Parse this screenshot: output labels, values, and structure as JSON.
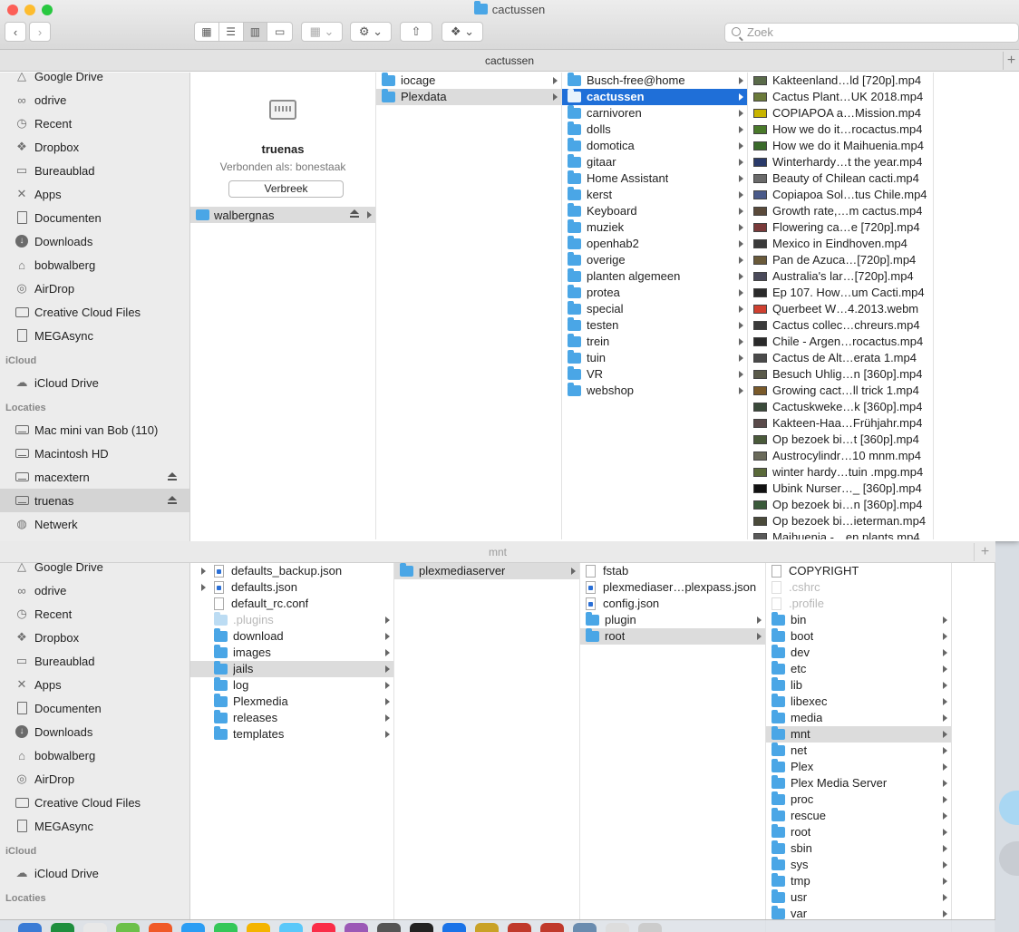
{
  "top": {
    "title": "cactussen",
    "path_title": "cactussen",
    "search_placeholder": "Zoek",
    "sidebar": {
      "items_a": [
        {
          "label": "Google Drive",
          "icon": "google-drive-icon",
          "glyph": "△"
        },
        {
          "label": "odrive",
          "icon": "odrive-icon",
          "glyph": "∞"
        },
        {
          "label": "Recent",
          "icon": "clock-icon",
          "glyph": "◷"
        },
        {
          "label": "Dropbox",
          "icon": "dropbox-icon",
          "glyph": "❖"
        },
        {
          "label": "Bureaublad",
          "icon": "desktop-icon",
          "glyph": "▭"
        },
        {
          "label": "Apps",
          "icon": "apps-icon",
          "glyph": "✕"
        },
        {
          "label": "Documenten",
          "icon": "document-icon",
          "glyph": "▯"
        },
        {
          "label": "Downloads",
          "icon": "downloads-icon",
          "glyph": "↓"
        },
        {
          "label": "bobwalberg",
          "icon": "home-icon",
          "glyph": "⌂"
        },
        {
          "label": "AirDrop",
          "icon": "airdrop-icon",
          "glyph": "◎"
        },
        {
          "label": "Creative Cloud Files",
          "icon": "folder-icon",
          "glyph": "▭"
        },
        {
          "label": "MEGAsync",
          "icon": "document-icon",
          "glyph": "▯"
        }
      ],
      "section_icloud": "iCloud",
      "icloud_drive": "iCloud Drive",
      "section_locaties": "Locaties",
      "items_b": [
        {
          "label": "Mac mini van Bob (110)",
          "icon": "computer-icon",
          "eject": false
        },
        {
          "label": "Macintosh HD",
          "icon": "disk-icon",
          "eject": false
        },
        {
          "label": "macextern",
          "icon": "external-disk-icon",
          "eject": true
        },
        {
          "label": "truenas",
          "icon": "server-icon",
          "eject": true,
          "selected": true
        },
        {
          "label": "Netwerk",
          "icon": "network-icon",
          "eject": false
        }
      ]
    },
    "server": {
      "name": "truenas",
      "connected_as": "Verbonden als: bonestaak",
      "disconnect_label": "Verbreek",
      "share": "walbergnas"
    },
    "col2": [
      {
        "label": "iocage",
        "sel": ""
      },
      {
        "label": "Plexdata",
        "sel": "grey"
      }
    ],
    "col3": [
      {
        "label": "Busch-free@home",
        "sel": ""
      },
      {
        "label": "cactussen",
        "sel": "blue"
      },
      {
        "label": "carnivoren",
        "sel": ""
      },
      {
        "label": "dolls",
        "sel": ""
      },
      {
        "label": "domotica",
        "sel": ""
      },
      {
        "label": "gitaar",
        "sel": ""
      },
      {
        "label": "Home Assistant",
        "sel": ""
      },
      {
        "label": "kerst",
        "sel": ""
      },
      {
        "label": "Keyboard",
        "sel": ""
      },
      {
        "label": "muziek",
        "sel": ""
      },
      {
        "label": "openhab2",
        "sel": ""
      },
      {
        "label": "overige",
        "sel": ""
      },
      {
        "label": "planten algemeen",
        "sel": ""
      },
      {
        "label": "protea",
        "sel": ""
      },
      {
        "label": "special",
        "sel": ""
      },
      {
        "label": "testen",
        "sel": ""
      },
      {
        "label": "trein",
        "sel": ""
      },
      {
        "label": "tuin",
        "sel": ""
      },
      {
        "label": "VR",
        "sel": ""
      },
      {
        "label": "webshop",
        "sel": ""
      }
    ],
    "col4": [
      {
        "label": "Kakteenland…ld [720p].mp4",
        "color": "#5a6b4a"
      },
      {
        "label": "Cactus Plant…UK 2018.mp4",
        "color": "#6b7a3a"
      },
      {
        "label": "COPIAPOA a…Mission.mp4",
        "color": "#c8b400"
      },
      {
        "label": "How we do it…rocactus.mp4",
        "color": "#4a7a2a"
      },
      {
        "label": "How we do it Maihuenia.mp4",
        "color": "#3a6a2a"
      },
      {
        "label": "Winterhardy…t the year.mp4",
        "color": "#2a3a6a"
      },
      {
        "label": "Beauty of Chilean cacti.mp4",
        "color": "#6a6a6a"
      },
      {
        "label": "Copiapoa Sol…tus Chile.mp4",
        "color": "#4a5a8a"
      },
      {
        "label": "Growth rate,…m cactus.mp4",
        "color": "#5a4a3a"
      },
      {
        "label": "Flowering ca…e [720p].mp4",
        "color": "#7a3a3a"
      },
      {
        "label": "Mexico in Eindhoven.mp4",
        "color": "#3a3a3a"
      },
      {
        "label": "Pan de Azuca…[720p].mp4",
        "color": "#6a5a3a"
      },
      {
        "label": "Australia's lar…[720p].mp4",
        "color": "#4a4a5a"
      },
      {
        "label": "Ep 107. How…um Cacti.mp4",
        "color": "#2a2a2a"
      },
      {
        "label": "Querbeet   W…4.2013.webm",
        "color": "#d04030"
      },
      {
        "label": "Cactus collec…chreurs.mp4",
        "color": "#3a3a3a"
      },
      {
        "label": "Chile - Argen…rocactus.mp4",
        "color": "#2a2a2a"
      },
      {
        "label": "Cactus de Alt…erata 1.mp4",
        "color": "#4a4a4a"
      },
      {
        "label": "Besuch Uhlig…n [360p].mp4",
        "color": "#5a5a4a"
      },
      {
        "label": "Growing cact…ll trick 1.mp4",
        "color": "#7a5a2a"
      },
      {
        "label": "Cactuskweke…k [360p].mp4",
        "color": "#3a4a3a"
      },
      {
        "label": "Kakteen-Haa…Frühjahr.mp4",
        "color": "#5a4a4a"
      },
      {
        "label": "Op bezoek bi…t [360p].mp4",
        "color": "#4a5a3a"
      },
      {
        "label": "Austrocylindr…10 mnm.mp4",
        "color": "#6a6a5a"
      },
      {
        "label": "winter hardy…tuin .mpg.mp4",
        "color": "#5a6a3a"
      },
      {
        "label": "Ubink Nurser…_ [360p].mp4",
        "color": "#111111"
      },
      {
        "label": "Op bezoek bi…n [360p].mp4",
        "color": "#3a5a3a"
      },
      {
        "label": "Op bezoek bi…ieterman.mp4",
        "color": "#4a4a3a"
      },
      {
        "label": "Maihuenia -…en plants.mp4",
        "color": "#5a5a5a"
      }
    ]
  },
  "bottom": {
    "path_title": "mnt",
    "sidebar": {
      "items_a": [
        {
          "label": "Google Drive",
          "icon": "google-drive-icon",
          "glyph": "△"
        },
        {
          "label": "odrive",
          "icon": "odrive-icon",
          "glyph": "∞"
        },
        {
          "label": "Recent",
          "icon": "clock-icon",
          "glyph": "◷"
        },
        {
          "label": "Dropbox",
          "icon": "dropbox-icon",
          "glyph": "❖"
        },
        {
          "label": "Bureaublad",
          "icon": "desktop-icon",
          "glyph": "▭"
        },
        {
          "label": "Apps",
          "icon": "apps-icon",
          "glyph": "✕"
        },
        {
          "label": "Documenten",
          "icon": "document-icon",
          "glyph": "▯"
        },
        {
          "label": "Downloads",
          "icon": "downloads-icon",
          "glyph": "↓"
        },
        {
          "label": "bobwalberg",
          "icon": "home-icon",
          "glyph": "⌂"
        },
        {
          "label": "AirDrop",
          "icon": "airdrop-icon",
          "glyph": "◎"
        },
        {
          "label": "Creative Cloud Files",
          "icon": "folder-icon",
          "glyph": "▭"
        },
        {
          "label": "MEGAsync",
          "icon": "document-icon",
          "glyph": "▯"
        }
      ],
      "section_icloud": "iCloud",
      "icloud_drive": "iCloud Drive",
      "section_locaties": "Locaties"
    },
    "col1": [
      {
        "label": "defaults_backup.json",
        "kind": "json"
      },
      {
        "label": "defaults.json",
        "kind": "json"
      },
      {
        "label": "default_rc.conf",
        "kind": "file"
      },
      {
        "label": ".plugins",
        "kind": "folder",
        "faded": true,
        "arrow": true
      },
      {
        "label": "download",
        "kind": "folder",
        "arrow": true
      },
      {
        "label": "images",
        "kind": "folder",
        "arrow": true
      },
      {
        "label": "jails",
        "kind": "folder",
        "arrow": true,
        "sel": "grey"
      },
      {
        "label": "log",
        "kind": "folder",
        "arrow": true
      },
      {
        "label": "Plexmedia",
        "kind": "folder",
        "arrow": true
      },
      {
        "label": "releases",
        "kind": "folder",
        "arrow": true
      },
      {
        "label": "templates",
        "kind": "folder",
        "arrow": true
      }
    ],
    "col2": [
      {
        "label": "plexmediaserver",
        "kind": "folder",
        "arrow": true,
        "sel": "grey"
      }
    ],
    "col3": [
      {
        "label": "fstab",
        "kind": "file"
      },
      {
        "label": "plexmediaser…plexpass.json",
        "kind": "json"
      },
      {
        "label": "config.json",
        "kind": "json"
      },
      {
        "label": "plugin",
        "kind": "folder",
        "arrow": true
      },
      {
        "label": "root",
        "kind": "folder",
        "arrow": true,
        "sel": "grey"
      }
    ],
    "col4": [
      {
        "label": "COPYRIGHT",
        "kind": "file"
      },
      {
        "label": ".cshrc",
        "kind": "file",
        "faded": true
      },
      {
        "label": ".profile",
        "kind": "file",
        "faded": true
      },
      {
        "label": "bin",
        "kind": "folder",
        "arrow": true
      },
      {
        "label": "boot",
        "kind": "folder",
        "arrow": true
      },
      {
        "label": "dev",
        "kind": "folder",
        "arrow": true
      },
      {
        "label": "etc",
        "kind": "folder",
        "arrow": true
      },
      {
        "label": "lib",
        "kind": "folder",
        "arrow": true
      },
      {
        "label": "libexec",
        "kind": "folder",
        "arrow": true
      },
      {
        "label": "media",
        "kind": "folder",
        "arrow": true
      },
      {
        "label": "mnt",
        "kind": "folder",
        "arrow": true,
        "sel": "grey"
      },
      {
        "label": "net",
        "kind": "folder",
        "arrow": true
      },
      {
        "label": "Plex",
        "kind": "folder",
        "arrow": true
      },
      {
        "label": "Plex Media Server",
        "kind": "folder",
        "arrow": true
      },
      {
        "label": "proc",
        "kind": "folder",
        "arrow": true
      },
      {
        "label": "rescue",
        "kind": "folder",
        "arrow": true
      },
      {
        "label": "root",
        "kind": "folder",
        "arrow": true
      },
      {
        "label": "sbin",
        "kind": "folder",
        "arrow": true
      },
      {
        "label": "sys",
        "kind": "folder",
        "arrow": true
      },
      {
        "label": "tmp",
        "kind": "folder",
        "arrow": true
      },
      {
        "label": "usr",
        "kind": "folder",
        "arrow": true
      },
      {
        "label": "var",
        "kind": "folder",
        "arrow": true
      }
    ]
  }
}
